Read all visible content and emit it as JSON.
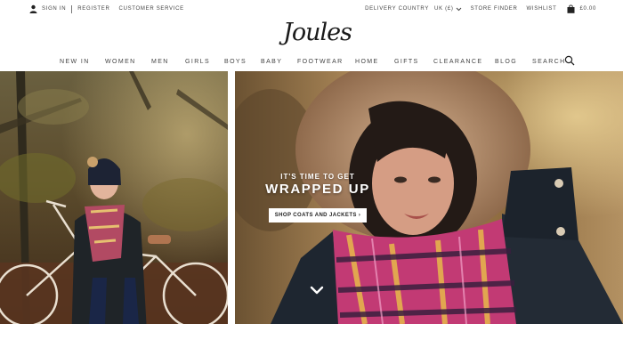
{
  "utility": {
    "sign_in": "SIGN IN",
    "register": "REGISTER",
    "customer_service": "CUSTOMER SERVICE",
    "delivery_country_label": "DELIVERY COUNTRY",
    "delivery_country_value": "UK (£)",
    "store_finder": "STORE FINDER",
    "wishlist": "WISHLIST",
    "basket_total": "£0.00"
  },
  "logo": {
    "text": "Joules"
  },
  "nav": {
    "items": [
      "NEW IN",
      "WOMEN",
      "MEN",
      "GIRLS",
      "BOYS",
      "BABY",
      "FOOTWEAR",
      "HOME",
      "GIFTS",
      "CLEARANCE",
      "BLOG",
      "SEARCH"
    ]
  },
  "hero": {
    "kicker": "IT'S TIME TO GET",
    "headline": "WRAPPED UP",
    "cta": "SHOP COATS AND JACKETS ›"
  },
  "icons": {
    "user": "user-icon",
    "chevron": "chevron-down-icon",
    "basket": "shopping-bag-icon",
    "search": "search-icon",
    "scroll": "chevron-down-icon"
  },
  "colors": {
    "text": "#444444",
    "promo_button": "#ffffff",
    "promo_text": "#ffffff"
  }
}
